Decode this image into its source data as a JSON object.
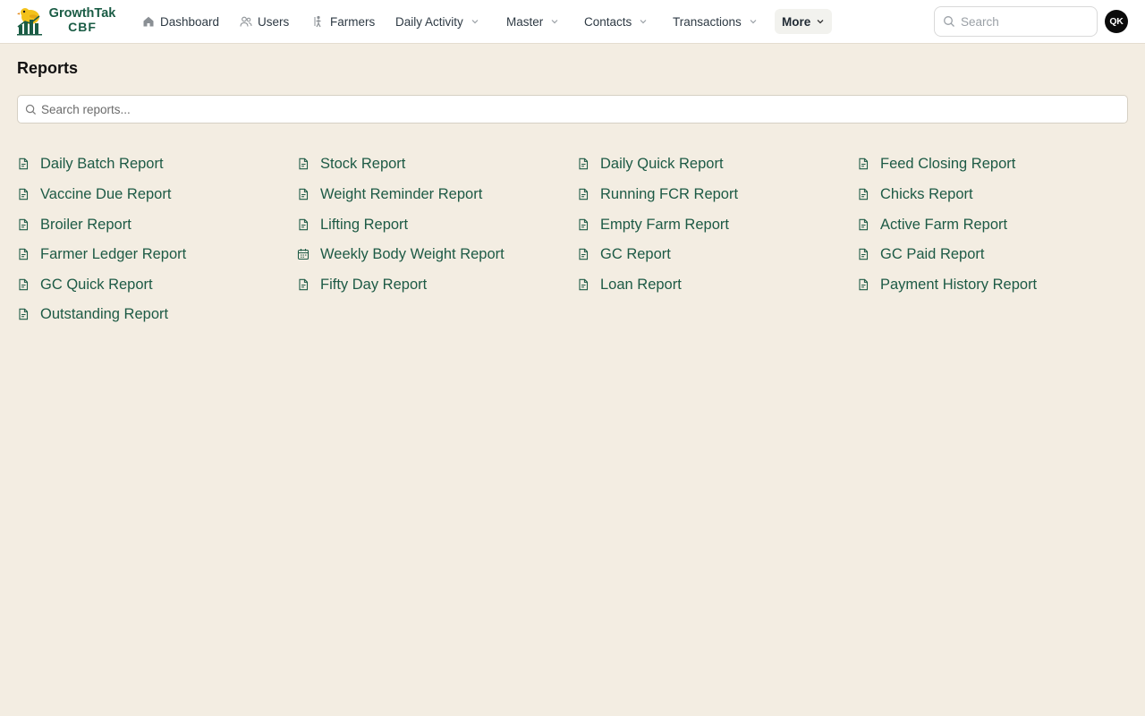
{
  "brand": {
    "line1": "GrowthTak",
    "line2": "CBF"
  },
  "nav": {
    "dashboard": "Dashboard",
    "users": "Users",
    "farmers": "Farmers",
    "daily_activity": "Daily Activity",
    "master": "Master",
    "contacts": "Contacts",
    "transactions": "Transactions",
    "more": "More"
  },
  "search": {
    "placeholder": "Search"
  },
  "user": {
    "initials": "QK"
  },
  "page": {
    "title": "Reports"
  },
  "reports_search": {
    "placeholder": "Search reports..."
  },
  "colors": {
    "accent": "#1d5a45",
    "background": "#f3ede2"
  },
  "reports": [
    {
      "label": "Daily Batch Report",
      "icon": "file-icon"
    },
    {
      "label": "Stock Report",
      "icon": "file-icon"
    },
    {
      "label": "Daily Quick Report",
      "icon": "file-icon"
    },
    {
      "label": "Feed Closing Report",
      "icon": "file-icon"
    },
    {
      "label": "Vaccine Due Report",
      "icon": "file-icon"
    },
    {
      "label": "Weight Reminder Report",
      "icon": "file-icon"
    },
    {
      "label": "Running FCR Report",
      "icon": "file-icon"
    },
    {
      "label": "Chicks Report",
      "icon": "file-icon"
    },
    {
      "label": "Broiler Report",
      "icon": "file-icon"
    },
    {
      "label": "Lifting Report",
      "icon": "file-icon"
    },
    {
      "label": "Empty Farm Report",
      "icon": "file-icon"
    },
    {
      "label": "Active Farm Report",
      "icon": "file-icon"
    },
    {
      "label": "Farmer Ledger Report",
      "icon": "file-icon"
    },
    {
      "label": "Weekly Body Weight Report",
      "icon": "calendar-icon"
    },
    {
      "label": "GC Report",
      "icon": "file-icon"
    },
    {
      "label": "GC Paid Report",
      "icon": "file-icon"
    },
    {
      "label": "GC Quick Report",
      "icon": "file-icon"
    },
    {
      "label": "Fifty Day Report",
      "icon": "file-icon"
    },
    {
      "label": "Loan Report",
      "icon": "file-icon"
    },
    {
      "label": "Payment History Report",
      "icon": "file-icon"
    },
    {
      "label": "Outstanding Report",
      "icon": "file-icon"
    }
  ]
}
